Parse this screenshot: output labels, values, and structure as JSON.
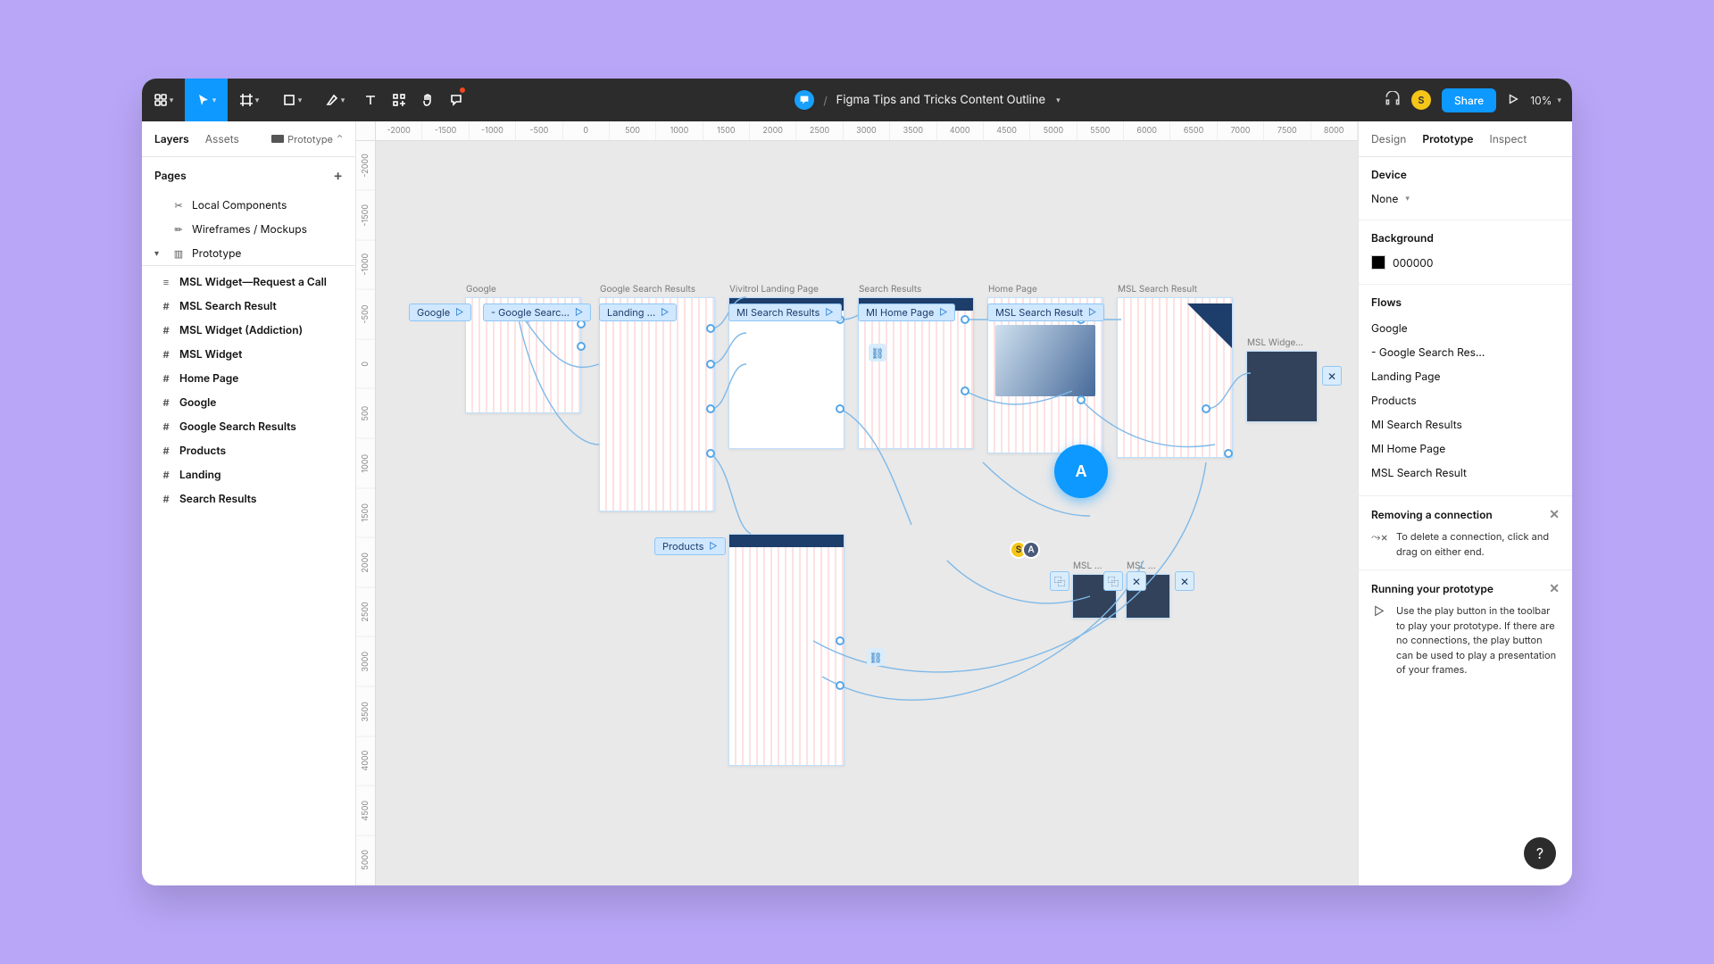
{
  "toolbar": {
    "file_title": "Figma Tips and Tricks Content Outline",
    "share_label": "Share",
    "zoom_label": "10%",
    "avatar_initial": "S"
  },
  "left_tabs": {
    "layers": "Layers",
    "assets": "Assets",
    "prototype_chip": "Prototype"
  },
  "pages_header": "Pages",
  "pages": [
    {
      "icon": "✂",
      "label": "Local Components"
    },
    {
      "icon": "✏",
      "label": "Wireframes / Mockups"
    },
    {
      "icon": "▥",
      "label": "Prototype",
      "selected": true
    }
  ],
  "layers": [
    {
      "label": "MSL Widget—Request a Call"
    },
    {
      "label": "MSL Search Result"
    },
    {
      "label": "MSL Widget (Addiction)"
    },
    {
      "label": "MSL Widget"
    },
    {
      "label": "Home Page"
    },
    {
      "label": "Google"
    },
    {
      "label": "Google Search Results"
    },
    {
      "label": "Products"
    },
    {
      "label": "Landing"
    },
    {
      "label": "Search Results"
    }
  ],
  "ruler_h": [
    "-2000",
    "-1500",
    "-1000",
    "-500",
    "0",
    "500",
    "1000",
    "1500",
    "2000",
    "2500",
    "3000",
    "3500",
    "4000",
    "4500",
    "5000",
    "5500",
    "6000",
    "6500",
    "7000",
    "7500",
    "8000"
  ],
  "ruler_v": [
    "-2000",
    "-1500",
    "-1000",
    "-500",
    "0",
    "500",
    "1000",
    "1500",
    "2000",
    "2500",
    "3000",
    "3500",
    "4000",
    "4500",
    "5000"
  ],
  "canvas": {
    "frame_labels": {
      "google": "Google",
      "gsr": "Google Search Results",
      "vivitrol": "Vivitrol Landing Page",
      "sr": "Search Results",
      "home": "Home Page",
      "mslsr": "MSL Search Result",
      "mslwidget": "MSL Widge...",
      "products": "Products",
      "msl_small1": "MSL ...",
      "msl_small2": "MSL ..."
    },
    "flow_chips": {
      "google": "Google",
      "gsearch": "- Google Searc...",
      "landing": "Landing ...",
      "misr": "MI Search Results",
      "mihome": "MI Home Page",
      "mslsr": "MSL Search Result",
      "products": "Products"
    },
    "cursor_label": "A",
    "mini_avatars": {
      "s": "S",
      "a": "A"
    }
  },
  "right_tabs": {
    "design": "Design",
    "prototype": "Prototype",
    "inspect": "Inspect"
  },
  "device_section": {
    "title": "Device",
    "value": "None"
  },
  "background_section": {
    "title": "Background",
    "value": "000000"
  },
  "flows_section": {
    "title": "Flows",
    "items": [
      "Google",
      "- Google Search Res...",
      "Landing Page",
      "Products",
      "MI Search Results",
      "MI Home Page",
      "MSL Search Result"
    ]
  },
  "tip1": {
    "title": "Removing a connection",
    "body": "To delete a connection, click and drag on either end."
  },
  "tip2": {
    "title": "Running your prototype",
    "body": "Use the play button in the toolbar to play your prototype. If there are no connections, the play button can be used to play a presentation of your frames."
  },
  "help_label": "?"
}
